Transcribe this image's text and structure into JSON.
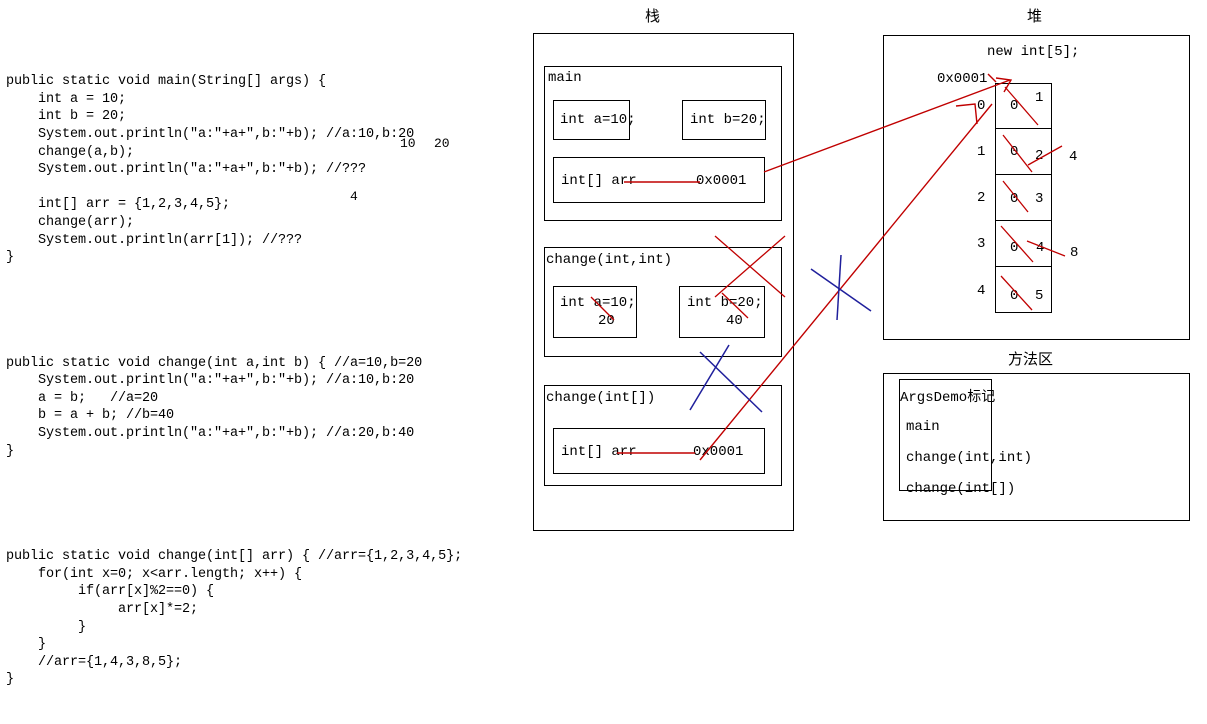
{
  "code": {
    "main_block": "public static void main(String[] args) {\n    int a = 10;\n    int b = 20;\n    System.out.println(\"a:\"+a+\",b:\"+b); //a:10,b:20\n    change(a,b);\n    System.out.println(\"a:\"+a+\",b:\"+b); //???\n\n    int[] arr = {1,2,3,4,5};\n    change(arr);\n    System.out.println(arr[1]); //???\n}",
    "change_int_block": "public static void change(int a,int b) { //a=10,b=20\n    System.out.println(\"a:\"+a+\",b:\"+b); //a:10,b:20\n    a = b;   //a=20\n    b = a + b; //b=40\n    System.out.println(\"a:\"+a+\",b:\"+b); //a:20,b:40\n}",
    "change_arr_block": "public static void change(int[] arr) { //arr={1,2,3,4,5};\n    for(int x=0; x<arr.length; x++) {\n         if(arr[x]%2==0) {\n              arr[x]*=2;\n         }\n    }\n    //arr={1,4,3,8,5};\n}",
    "answer_a": "10",
    "answer_b": "20",
    "answer_arr1": "4"
  },
  "stack": {
    "title": "栈",
    "frames": [
      {
        "name": "main",
        "vars": [
          {
            "text": "int a=10;"
          },
          {
            "text": "int b=20;"
          },
          {
            "text": "int[] arr",
            "value": "0x0001"
          }
        ]
      },
      {
        "name": "change(int,int)",
        "vars": [
          {
            "text": "int a=10;",
            "updated": "20"
          },
          {
            "text": "int b=20;",
            "updated": "40"
          }
        ]
      },
      {
        "name": "change(int[])",
        "vars": [
          {
            "text": "int[] arr",
            "value": "0x0001"
          }
        ]
      }
    ]
  },
  "heap": {
    "title": "堆",
    "alloc_label": "new int[5];",
    "address": "0x0001",
    "cells": [
      {
        "index": "0",
        "initial": "0",
        "value": "1",
        "updated": ""
      },
      {
        "index": "1",
        "initial": "0",
        "value": "2",
        "updated": "4"
      },
      {
        "index": "2",
        "initial": "0",
        "value": "3",
        "updated": ""
      },
      {
        "index": "3",
        "initial": "0",
        "value": "4",
        "updated": "8"
      },
      {
        "index": "4",
        "initial": "0",
        "value": "5",
        "updated": ""
      }
    ]
  },
  "method_area": {
    "title": "方法区",
    "class_label": "ArgsDemo标记",
    "methods": [
      "main",
      "change(int,int)",
      "change(int[])"
    ]
  },
  "colors": {
    "ink": "#000000",
    "red": "#c00000",
    "blue": "#1f1f9c"
  }
}
